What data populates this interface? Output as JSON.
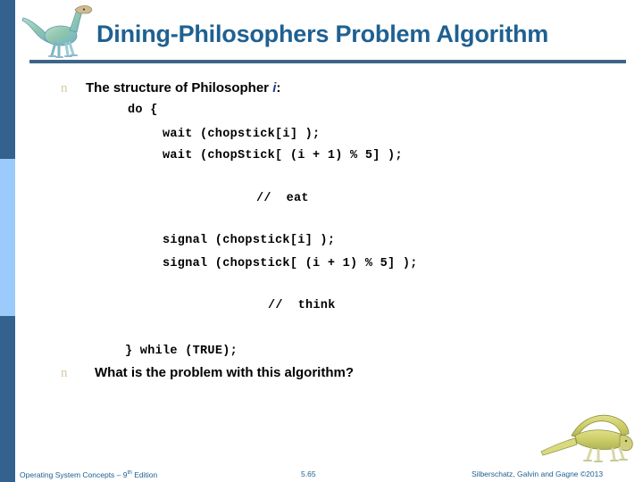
{
  "slide": {
    "title": "Dining-Philosophers Problem Algorithm",
    "accent_color": "#1f6091",
    "band_dark_color": "#33628f",
    "band_light_color": "#9bcbfb",
    "rule_color": "#3d6589",
    "bullet_marker": "n"
  },
  "bullets": [
    {
      "marker": "n",
      "text_before": "The structure of Philosopher ",
      "italic_token": "i",
      "text_after": ":"
    },
    {
      "marker": "n",
      "text": "What is the problem with this algorithm?"
    }
  ],
  "code": {
    "lines": [
      "do {",
      "wait (chopstick[i] );",
      "wait (chopStick[ (i + 1) % 5] );",
      "//  eat",
      "signal (chopstick[i] );",
      "signal (chopstick[ (i + 1) % 5] );",
      "//  think",
      "} while (TRUE);"
    ]
  },
  "footer": {
    "left_main": "Operating System Concepts – 9",
    "left_sup": "th",
    "left_tail": " Edition",
    "page_number": "5.65",
    "right": "Silberschatz, Galvin and Gagne ©2013"
  },
  "icons": {
    "header_logo": "dinosaur-logo",
    "footer_logo": "dinosaur-logo"
  }
}
